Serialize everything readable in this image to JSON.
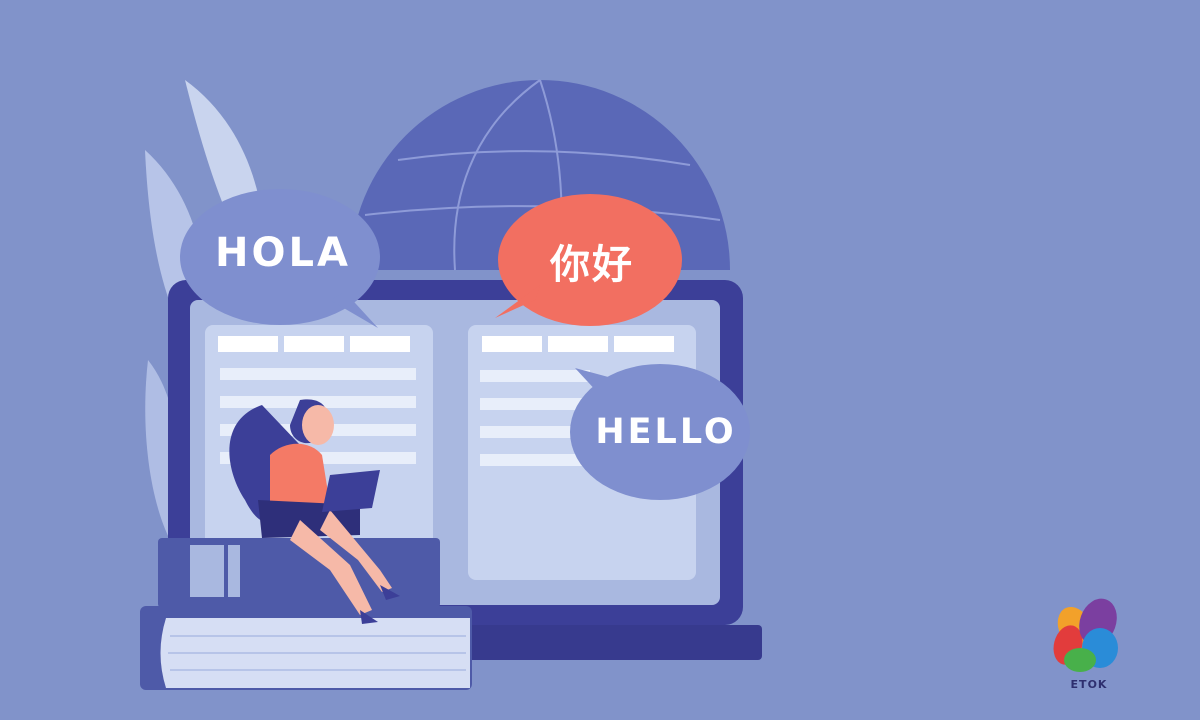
{
  "colors": {
    "background": "#8193CA",
    "globe": "#5A68B7",
    "laptop_frame": "#3C3F98",
    "screen": "#A9B8E0",
    "bubble_blue": "#7F8FCF",
    "bubble_orange": "#F26F61",
    "book_light": "#D6DEF4",
    "person_shirt": "#F47A66"
  },
  "bubbles": {
    "hola": "HOLA",
    "nihao": "你好",
    "hello": "HELLO"
  },
  "logo": {
    "wordmark": "ETOK"
  }
}
